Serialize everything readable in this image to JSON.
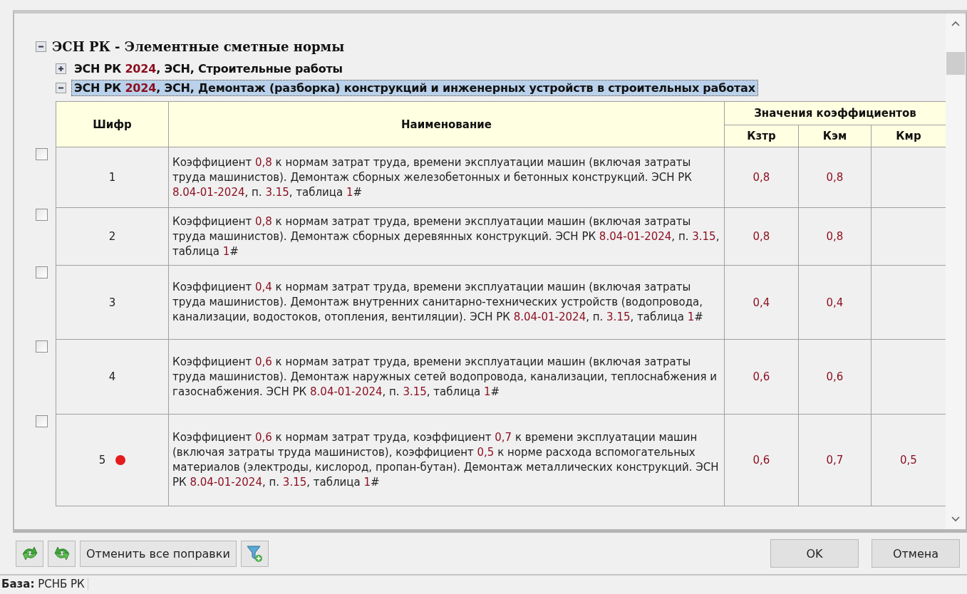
{
  "tree": {
    "label": "ЭСН РК - Элементные сметные нормы",
    "expanded": true,
    "children": [
      {
        "title": [
          {
            "text": "ЭСН РК "
          },
          {
            "text": "2024",
            "highlight": true
          },
          {
            "text": ", ЭСН, Строительные работы"
          }
        ],
        "expanded": false,
        "selected": false
      },
      {
        "title": [
          {
            "text": "ЭСН РК "
          },
          {
            "text": "2024",
            "highlight": true
          },
          {
            "text": ", ЭСН, Демонтаж (разборка) конструкций и инженерных устройств в строительных работах"
          }
        ],
        "expanded": true,
        "selected": true,
        "table": {
          "columns": {
            "code": "Шифр",
            "name": "Наименование",
            "group": "Значения коэффициентов",
            "factors": [
              "Кзтр",
              "Кэм",
              "Кмр"
            ]
          },
          "rows": [
            {
              "checked": false,
              "code": "1",
              "flagged": false,
              "description": [
                {
                  "text": "Коэффициент "
                },
                {
                  "text": "0,8",
                  "highlight": true
                },
                {
                  "text": " к нормам затрат труда, времени эксплуатации машин (включая затраты труда машинистов). Демонтаж сборных железобетонных и бетонных конструкций. ЭСН РК "
                },
                {
                  "text": "8.04-01-2024",
                  "highlight": true
                },
                {
                  "text": ", п. "
                },
                {
                  "text": "3.15",
                  "highlight": true
                },
                {
                  "text": ", таблица "
                },
                {
                  "text": "1",
                  "highlight": true
                },
                {
                  "text": "#"
                }
              ],
              "factors": [
                "0,8",
                "0,8"
              ]
            },
            {
              "checked": false,
              "code": "2",
              "flagged": false,
              "description": [
                {
                  "text": "Коэффициент "
                },
                {
                  "text": "0,8",
                  "highlight": true
                },
                {
                  "text": " к нормам затрат труда, времени эксплуатации машин (включая затраты труда машинистов). Демонтаж сборных деревянных конструкций. ЭСН РК "
                },
                {
                  "text": "8.04-01-2024",
                  "highlight": true
                },
                {
                  "text": ", п. "
                },
                {
                  "text": "3.15",
                  "highlight": true
                },
                {
                  "text": ", таблица "
                },
                {
                  "text": "1",
                  "highlight": true
                },
                {
                  "text": "#"
                }
              ],
              "factors": [
                "0,8",
                "0,8"
              ]
            },
            {
              "checked": false,
              "code": "3",
              "flagged": false,
              "description": [
                {
                  "text": "Коэффициент "
                },
                {
                  "text": "0,4",
                  "highlight": true
                },
                {
                  "text": " к нормам затрат труда, времени эксплуатации машин (включая затраты труда машинистов). Демонтаж внутренних санитарно-технических устройств (водопровода, канализации, водостоков, отопления, вентиляции). ЭСН РК "
                },
                {
                  "text": "8.04-01-2024",
                  "highlight": true
                },
                {
                  "text": ", п. "
                },
                {
                  "text": "3.15",
                  "highlight": true
                },
                {
                  "text": ", таблица "
                },
                {
                  "text": "1",
                  "highlight": true
                },
                {
                  "text": "#"
                }
              ],
              "factors": [
                "0,4",
                "0,4"
              ]
            },
            {
              "checked": false,
              "code": "4",
              "flagged": false,
              "description": [
                {
                  "text": "Коэффициент "
                },
                {
                  "text": "0,6",
                  "highlight": true
                },
                {
                  "text": " к нормам затрат труда, времени эксплуатации машин (включая затраты труда машинистов). Демонтаж наружных сетей водопровода, канализации, теплоснабжения и газоснабжения. ЭСН РК "
                },
                {
                  "text": "8.04-01-2024",
                  "highlight": true
                },
                {
                  "text": ", п. "
                },
                {
                  "text": "3.15",
                  "highlight": true
                },
                {
                  "text": ", таблица "
                },
                {
                  "text": "1",
                  "highlight": true
                },
                {
                  "text": "#"
                }
              ],
              "factors": [
                "0,6",
                "0,6"
              ]
            },
            {
              "checked": false,
              "code": "5",
              "flagged": true,
              "description": [
                {
                  "text": "Коэффициент "
                },
                {
                  "text": "0,6",
                  "highlight": true
                },
                {
                  "text": " к нормам затрат труда, коэффициент "
                },
                {
                  "text": "0,7",
                  "highlight": true
                },
                {
                  "text": " к времени эксплуатации машин (включая затраты труда машинистов), коэффициент "
                },
                {
                  "text": "0,5",
                  "highlight": true
                },
                {
                  "text": " к норме расхода вспомогательных материалов (электроды, кислород, пропан-бутан). Демонтаж металлических конструкций. ЭСН РК "
                },
                {
                  "text": "8.04-01-2024",
                  "highlight": true
                },
                {
                  "text": ", п. "
                },
                {
                  "text": "3.15",
                  "highlight": true
                },
                {
                  "text": ", таблица "
                },
                {
                  "text": "1",
                  "highlight": true
                },
                {
                  "text": "#"
                }
              ],
              "factors": [
                "0,6",
                "0,7",
                "0,5"
              ]
            }
          ]
        }
      }
    ]
  },
  "toolbar": {
    "reset_button": "Отменить все поправки"
  },
  "dialog_buttons": [
    "OK",
    "Отмена"
  ],
  "status_bar": {
    "label": "База:",
    "value": "РСНБ РК"
  }
}
